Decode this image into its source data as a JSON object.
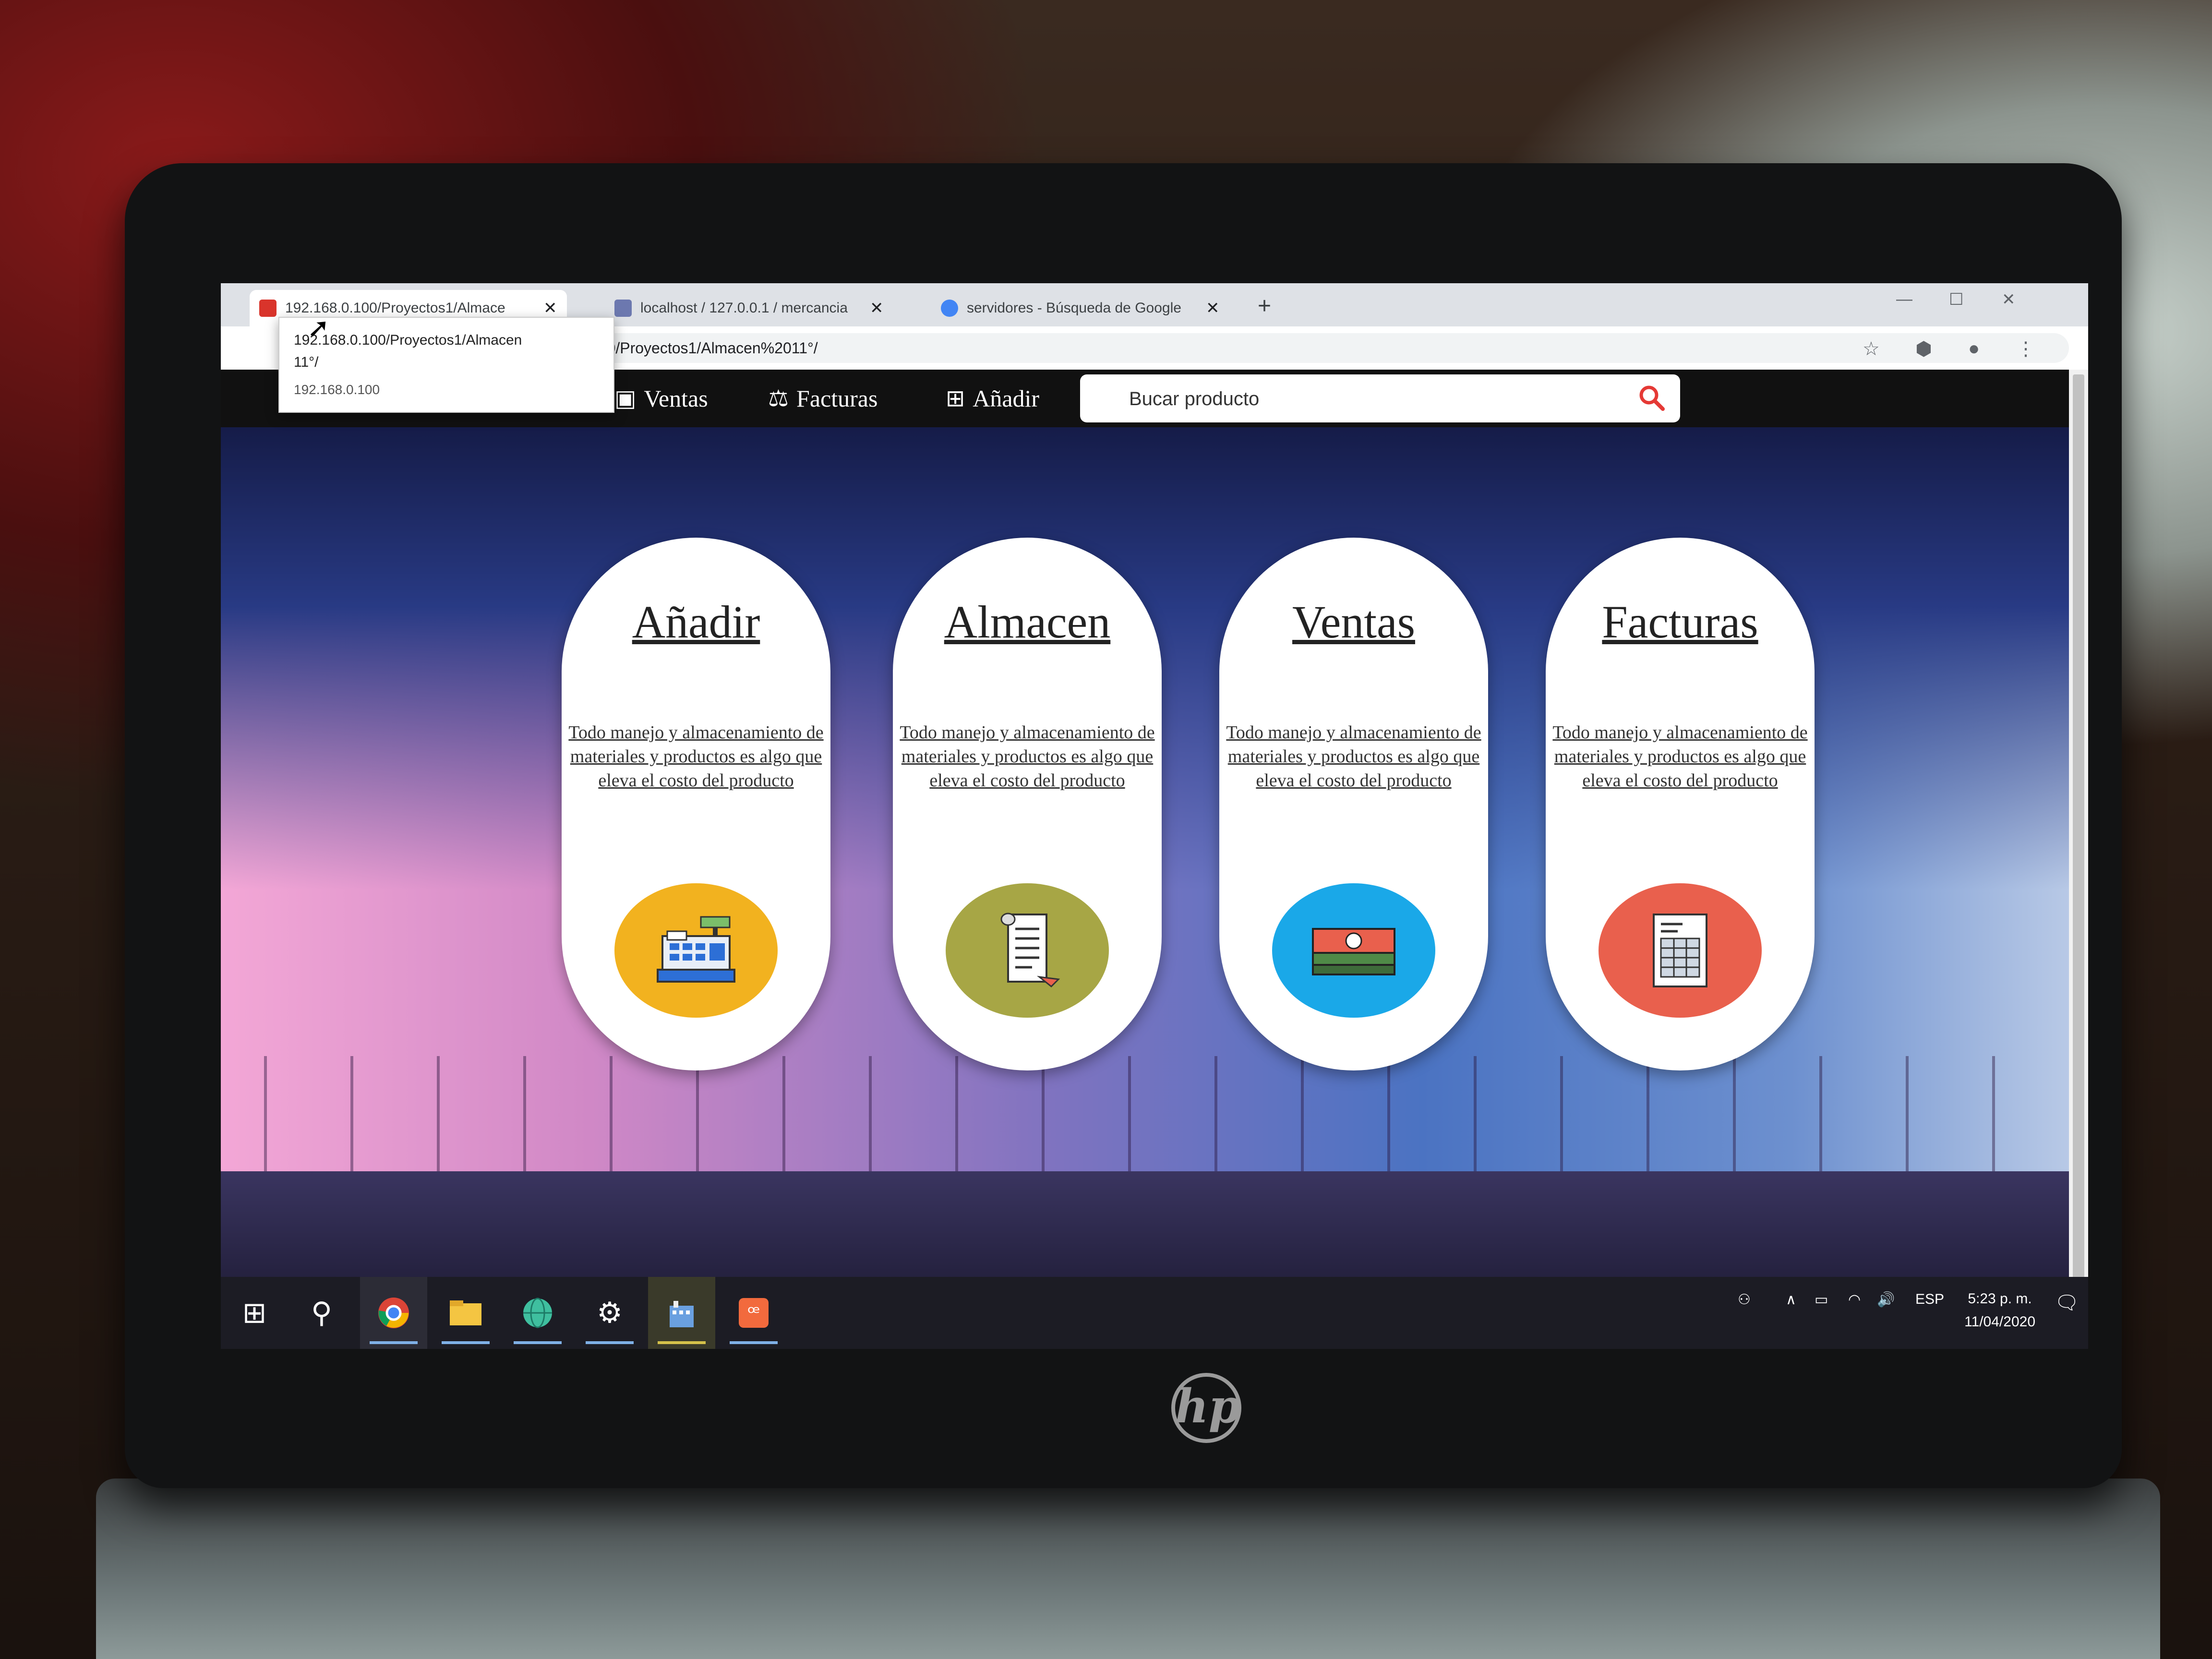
{
  "browser": {
    "tabs": [
      {
        "title": "192.168.0.100/Proyectos1/Almace",
        "favicon_color": "#d9342b",
        "active": true
      },
      {
        "title": "localhost / 127.0.0.1 / mercancia",
        "favicon_color": "#6c78af",
        "active": false
      },
      {
        "title": "servidores - Búsqueda de Google",
        "favicon_color": "#4285f4",
        "active": false
      }
    ],
    "new_tab": "+",
    "address": "168.0.100/Proyectos1/Almacen%2011°/",
    "tooltip": {
      "line1": "192.168.0.100/Proyectos1/Almacen",
      "line2": "11°/",
      "host": "192.168.0.100"
    }
  },
  "nav": {
    "items": [
      {
        "label": "Ventas",
        "icon": "store-icon"
      },
      {
        "label": "Facturas",
        "icon": "balance-scale-icon"
      },
      {
        "label": "Añadir",
        "icon": "plus-square-icon"
      }
    ],
    "search": {
      "placeholder": "Bucar producto",
      "icon": "search-icon"
    }
  },
  "cards": [
    {
      "title": "Añadir",
      "text": "Todo manejo y almacenamiento de materiales y productos es algo que eleva el costo del producto",
      "icon": "cash-register-icon",
      "color": "#f2b21f"
    },
    {
      "title": "Almacen",
      "text": "Todo manejo y almacenamiento de materiales y productos es algo que eleva el costo del producto",
      "icon": "receipt-scroll-icon",
      "color": "#a7a645"
    },
    {
      "title": "Ventas",
      "text": "Todo manejo y almacenamiento de materiales y productos es algo que eleva el costo del producto",
      "icon": "money-stack-icon",
      "color": "#1aa8e8"
    },
    {
      "title": "Facturas",
      "text": "Todo manejo y almacenamiento de materiales y productos es algo que eleva el costo del producto",
      "icon": "invoice-icon",
      "color": "#e9604d"
    }
  ],
  "taskbar": {
    "lang": "ESP",
    "time": "5:23 p. m.",
    "date": "11/04/2020"
  },
  "device": {
    "brand": "hp"
  },
  "colors": {
    "nav_bg": "#111111",
    "search_icon": "#e53935"
  }
}
